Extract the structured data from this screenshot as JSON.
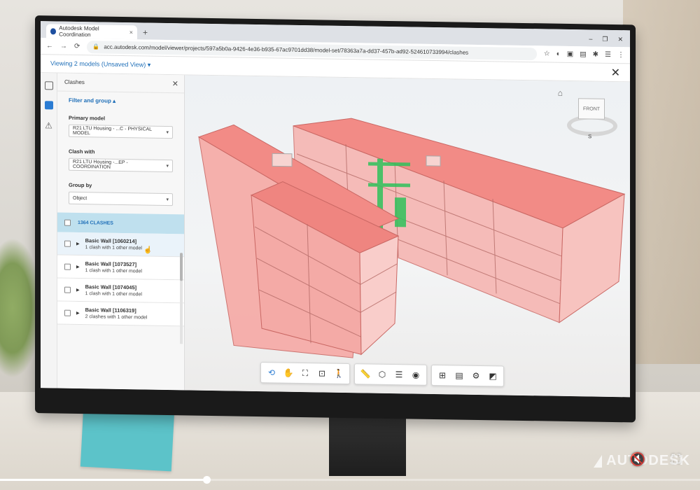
{
  "browser": {
    "tab_title": "Autodesk Model Coordination",
    "tab_close": "×",
    "new_tab": "+",
    "url": "acc.autodesk.com/model/viewer/projects/597a5b0a-9426-4e36-b935-67ac9701dd38/model-set/78363a7a-dd37-457b-ad92-524610733994/clashes",
    "window_buttons": [
      "–",
      "❐",
      "✕"
    ],
    "nav": [
      "←",
      "→",
      "⟳"
    ],
    "extensions": [
      "☆",
      "◐",
      "▣",
      "▤",
      "✱",
      "☰",
      "⋮"
    ]
  },
  "app": {
    "viewing_label": "Viewing 2 models (Unsaved View) ▾",
    "close": "✕"
  },
  "panel": {
    "title": "Clashes",
    "close": "✕",
    "filter_toggle": "Filter and group ▴",
    "primary_model_label": "Primary model",
    "primary_model_value": "R21 LTU Housing - ...C - PHYSICAL MODEL",
    "clash_with_label": "Clash with",
    "clash_with_value": "R21 LTU Housing -...EP - COORDINATION",
    "group_by_label": "Group by",
    "group_by_value": "Object",
    "clash_count": "1364 CLASHES",
    "rows": [
      {
        "title": "Basic Wall [1060214]",
        "sub": "1 clash with 1 other model"
      },
      {
        "title": "Basic Wall [1073527]",
        "sub": "1 clash with 1 other model"
      },
      {
        "title": "Basic Wall [1074045]",
        "sub": "1 clash with 1 other model"
      },
      {
        "title": "Basic Wall [1106319]",
        "sub": "2 clashes with 1 other model"
      }
    ]
  },
  "viewer": {
    "viewcube_face": "FRONT",
    "viewcube_compass": "S",
    "model_color": "#f28b86",
    "clash_color": "#2fc25b"
  },
  "toolbar": {
    "groups": [
      [
        "orbit-icon",
        "pan-icon",
        "fit-icon",
        "zoom-window-icon",
        "walk-icon"
      ],
      [
        "measure-icon",
        "section-icon",
        "layers-icon",
        "ghost-icon"
      ],
      [
        "model-browser-icon",
        "properties-icon",
        "settings-icon",
        "fullscreen-icon"
      ]
    ]
  },
  "video": {
    "brand": "AUTODESK",
    "progress": 0.295,
    "mute": "🔇",
    "fullscreen": "⛶"
  }
}
